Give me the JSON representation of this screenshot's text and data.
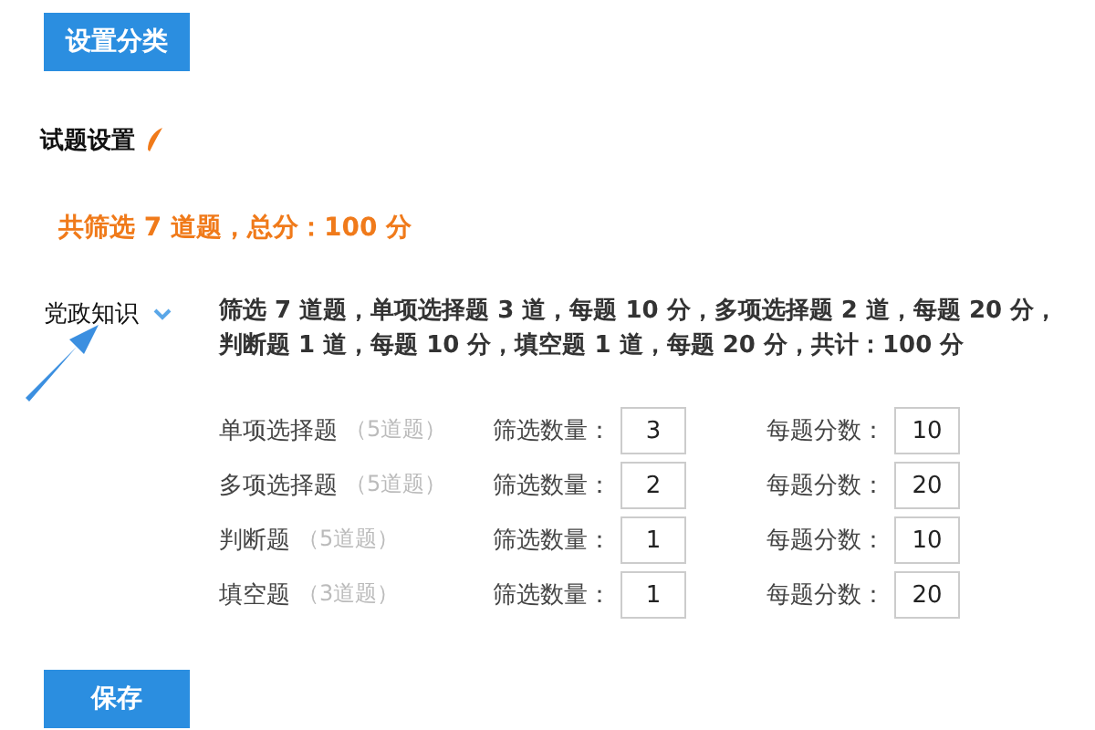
{
  "top_button": "设置分类",
  "section_title": "试题设置",
  "total_summary": "共筛选 7 道题，总分：100 分",
  "category": {
    "name": "党政知识",
    "expanded": true,
    "summary": "筛选 7 道题，单项选择题 3 道，每题 10 分，多项选择题 2 道，每题 20 分，判断题 1 道，每题 10 分，填空题 1 道，每题 20 分，共计：100 分",
    "rows": [
      {
        "type": "单项选择题",
        "available": "（5道题）",
        "count_label": "筛选数量：",
        "count": "3",
        "score_label": "每题分数：",
        "score": "10"
      },
      {
        "type": "多项选择题",
        "available": "（5道题）",
        "count_label": "筛选数量：",
        "count": "2",
        "score_label": "每题分数：",
        "score": "20"
      },
      {
        "type": "判断题",
        "available": "（5道题）",
        "count_label": "筛选数量：",
        "count": "1",
        "score_label": "每题分数：",
        "score": "10"
      },
      {
        "type": "填空题",
        "available": "（3道题）",
        "count_label": "筛选数量：",
        "count": "1",
        "score_label": "每题分数：",
        "score": "20"
      }
    ]
  },
  "save_button": "保存"
}
